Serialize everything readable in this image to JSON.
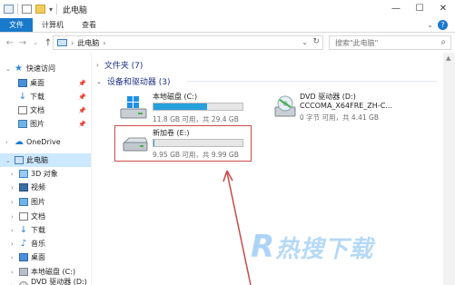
{
  "window": {
    "title": "此电脑"
  },
  "ribbon": {
    "tabs": [
      "文件",
      "计算机",
      "查看"
    ]
  },
  "address": {
    "crumb": "此电脑"
  },
  "search": {
    "placeholder": "搜索\"此电脑\""
  },
  "sidebar": {
    "items": [
      {
        "label": "快速访问",
        "icon": "star-icon"
      },
      {
        "label": "桌面",
        "icon": "desktop-icon",
        "pinned": true
      },
      {
        "label": "下载",
        "icon": "download-icon",
        "pinned": true
      },
      {
        "label": "文档",
        "icon": "document-icon",
        "pinned": true
      },
      {
        "label": "图片",
        "icon": "picture-icon",
        "pinned": true
      },
      {
        "label": "OneDrive",
        "icon": "cloud-icon"
      },
      {
        "label": "此电脑",
        "icon": "computer-icon",
        "selected": true
      },
      {
        "label": "3D 对象",
        "icon": "3d-objects-icon"
      },
      {
        "label": "视频",
        "icon": "video-icon"
      },
      {
        "label": "图片",
        "icon": "picture-icon"
      },
      {
        "label": "文档",
        "icon": "document-icon"
      },
      {
        "label": "下载",
        "icon": "download-icon"
      },
      {
        "label": "音乐",
        "icon": "music-icon"
      },
      {
        "label": "桌面",
        "icon": "desktop-icon"
      },
      {
        "label": "本地磁盘 (C:)",
        "icon": "drive-icon"
      },
      {
        "label": "DVD 驱动器 (D:) C",
        "icon": "dvd-icon"
      }
    ]
  },
  "groups": {
    "folders": "文件夹 (7)",
    "devices": "设备和驱动器 (3)"
  },
  "drives": [
    {
      "name": "本地磁盘 (C:)",
      "size": "11.8 GB 可用，共 29.4 GB",
      "used_fraction": 0.6,
      "icon": "windows-drive-icon"
    },
    {
      "name": "DVD 驱动器 (D:)",
      "name2": "CCCOMA_X64FRE_ZH-C...",
      "size": "0 字节 可用，共 4.41 GB",
      "icon": "dvd-drive-icon"
    },
    {
      "name": "新加卷 (E:)",
      "size": "9.95 GB 可用，共 9.99 GB",
      "used_fraction": 0.004,
      "icon": "drive-icon"
    }
  ],
  "watermark": {
    "text": "热搜下载"
  },
  "colors": {
    "accent": "#1979ca",
    "selected": "#cce8ff",
    "bar_fill": "#26a0da",
    "highlight": "#c94a4a"
  }
}
